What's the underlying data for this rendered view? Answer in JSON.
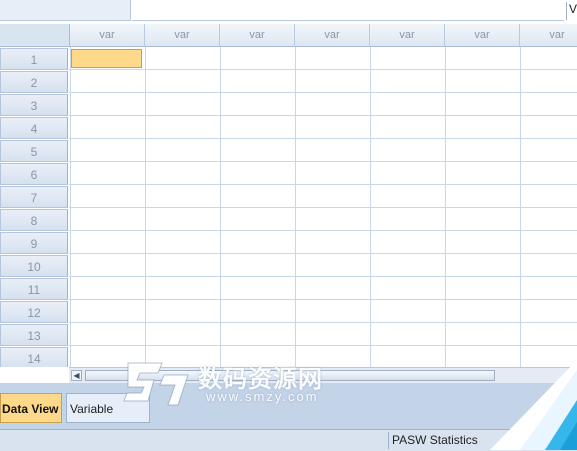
{
  "top_strip": {
    "value_label": "V"
  },
  "grid": {
    "columns": [
      "var",
      "var",
      "var",
      "var",
      "var",
      "var",
      "var"
    ],
    "rows": [
      "1",
      "2",
      "3",
      "4",
      "5",
      "6",
      "7",
      "8",
      "9",
      "10",
      "11",
      "12",
      "13",
      "14"
    ],
    "active_cell": {
      "row": "1",
      "column": 1
    }
  },
  "scrollbar": {
    "left_arrow": "◀"
  },
  "tabs": {
    "data_view": "Data View",
    "variable_view": "Variable"
  },
  "status": {
    "text": "PASW Statistics "
  },
  "watermark": {
    "title": "数码资源网",
    "url": "www.smzy.com"
  },
  "colors": {
    "active_cell": "#ffd98a",
    "header_bg": "#dde6f2",
    "tab_strip": "#c3d3e8",
    "grid_line": "#c9d7ea"
  }
}
